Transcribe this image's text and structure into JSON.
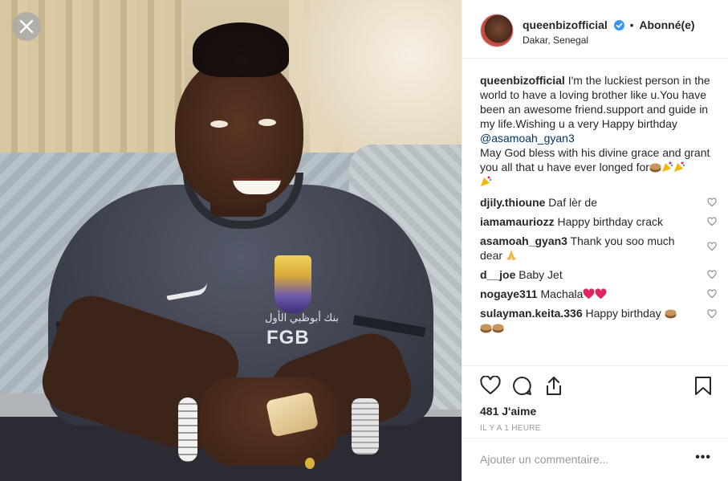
{
  "header": {
    "username": "queenbizofficial",
    "separator": "•",
    "follow_label": "Abonné(e)",
    "location": "Dakar, Senegal"
  },
  "photo": {
    "jersey_text": "FGB",
    "jersey_arabic": "بنك أبوظبي الأول"
  },
  "caption": {
    "username": "queenbizofficial",
    "text": "I'm the luckiest person in the world to have a loving brother like u.You have been an awesome friend.support and guide in my life.Wishing u a very Happy birthday",
    "mention": "@asamoah_gyan3",
    "text2": "May God bless with his divine grace and grant you all that u have ever longed for"
  },
  "comments": [
    {
      "username": "djily.thioune",
      "text": "Daf lèr de"
    },
    {
      "username": "iamamauriozz",
      "text": "Happy birthday crack"
    },
    {
      "username": "asamoah_gyan3",
      "text": "Thank you soo much dear"
    },
    {
      "username": "d__joe",
      "text": "Baby Jet"
    },
    {
      "username": "nogaye311",
      "text": "Machala"
    },
    {
      "username": "sulayman.keita.336",
      "text": "Happy birthday"
    }
  ],
  "stats": {
    "likes": "481 J'aime",
    "time": "IL Y A 1 HEURE"
  },
  "composer": {
    "placeholder": "Ajouter un commentaire...",
    "more_label": "•••"
  },
  "icons": {
    "close": "close-icon",
    "verified": "verified-badge-icon",
    "heart": "heart-icon",
    "comment": "comment-icon",
    "share": "share-icon",
    "save": "bookmark-icon"
  },
  "colors": {
    "verified": "#3897f0",
    "mention": "#003569",
    "muted": "#999999",
    "heart_red": "#ed4956"
  }
}
